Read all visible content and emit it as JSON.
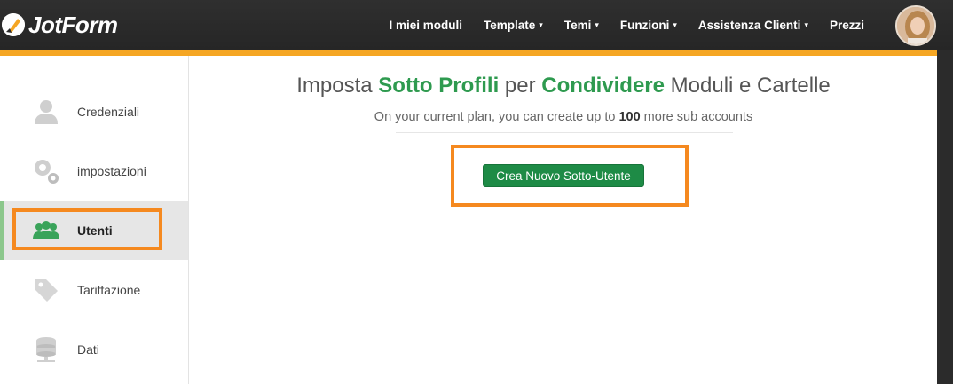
{
  "app": {
    "logo_text": "JotForm"
  },
  "nav": {
    "items": [
      {
        "label": "I miei moduli",
        "dropdown": false
      },
      {
        "label": "Template",
        "dropdown": true
      },
      {
        "label": "Temi",
        "dropdown": true
      },
      {
        "label": "Funzioni",
        "dropdown": true
      },
      {
        "label": "Assistenza Clienti",
        "dropdown": true
      },
      {
        "label": "Prezzi",
        "dropdown": false
      }
    ],
    "caret": "▾"
  },
  "sidebar": {
    "items": [
      {
        "label": "Credenziali",
        "icon": "user-icon",
        "active": false
      },
      {
        "label": "impostazioni",
        "icon": "gears-icon",
        "active": false
      },
      {
        "label": "Utenti",
        "icon": "users-icon",
        "active": true
      },
      {
        "label": "Tariffazione",
        "icon": "tag-icon",
        "active": false
      },
      {
        "label": "Dati",
        "icon": "database-icon",
        "active": false
      }
    ]
  },
  "main": {
    "headline": {
      "part1": "Imposta ",
      "bold1": "Sotto Profili",
      "part2": " per ",
      "bold2": "Condividere",
      "part3": " Moduli e Cartelle"
    },
    "subline": {
      "before": "On your current plan, you can create up to ",
      "count": "100",
      "after": " more sub accounts"
    },
    "create_button": "Crea Nuovo Sotto-Utente"
  },
  "colors": {
    "accent_green": "#2e9a4f",
    "button_green": "#1e8b46",
    "highlight_orange": "#f5891f",
    "strip_orange": "#f5a623"
  }
}
